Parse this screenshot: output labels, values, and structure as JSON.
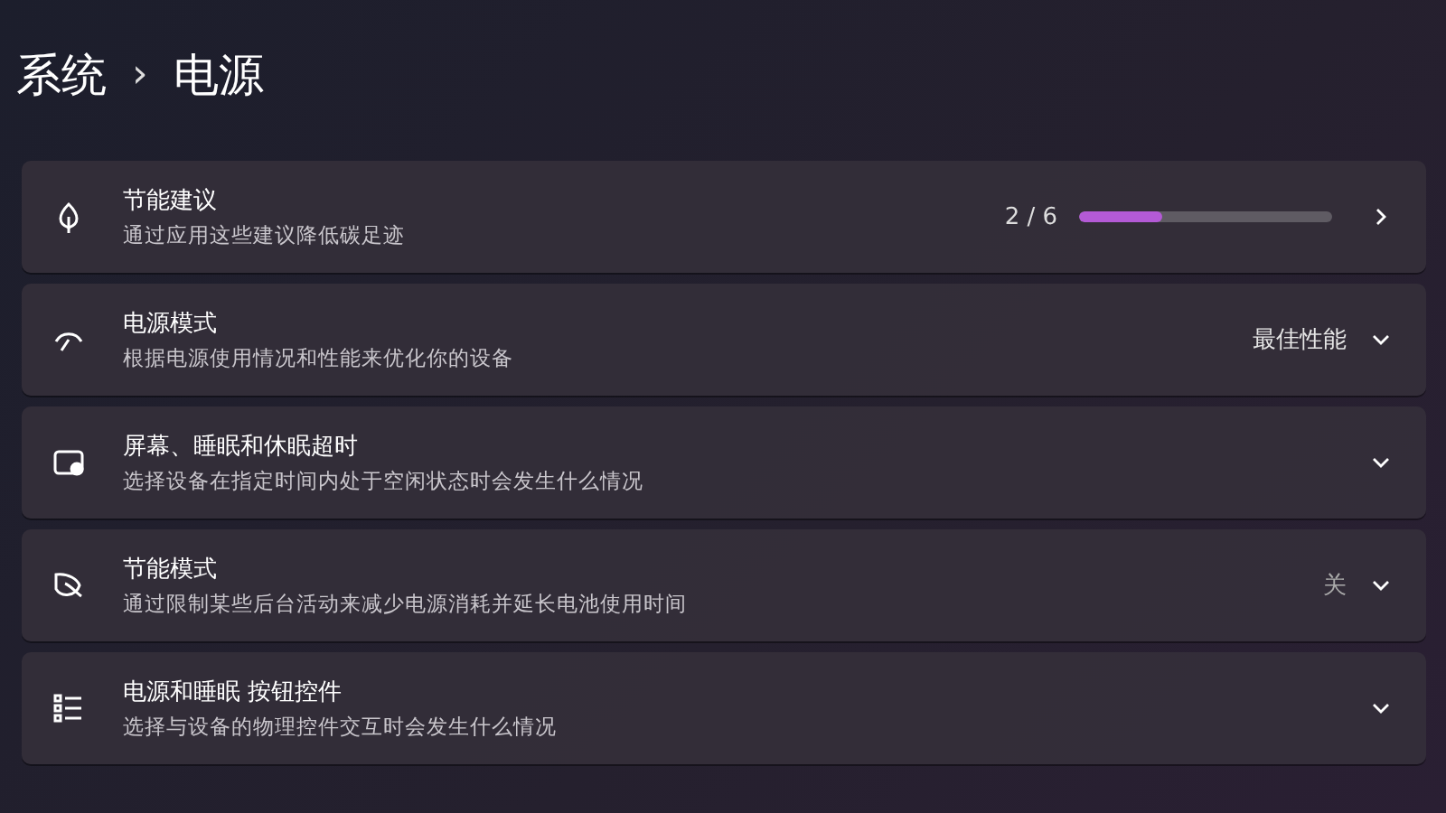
{
  "breadcrumb": {
    "parent": "系统",
    "separator": "›",
    "current": "电源"
  },
  "cards": [
    {
      "kind": "progress",
      "title": "节能建议",
      "subtitle": "通过应用这些建议降低碳足迹",
      "reading": "2 / 6",
      "level": 0.33,
      "expandable": false
    },
    {
      "kind": "value",
      "title": "电源模式",
      "subtitle": "根据电源使用情况和性能来优化你的设备",
      "value": "最佳性能",
      "expandable": true
    },
    {
      "kind": "plain",
      "title": "屏幕、睡眠和休眠超时",
      "subtitle": "选择设备在指定时间内处于空闲状态时会发生什么情况",
      "expandable": true
    },
    {
      "kind": "value",
      "title": "节能模式",
      "subtitle": "通过限制某些后台活动来减少电源消耗并延长电池使用时间",
      "value": "关",
      "expandable": true
    },
    {
      "kind": "plain",
      "title": "电源和睡眠 按钮控件",
      "subtitle": "选择与设备的物理控件交互时会发生什么情况",
      "expandable": true
    }
  ]
}
